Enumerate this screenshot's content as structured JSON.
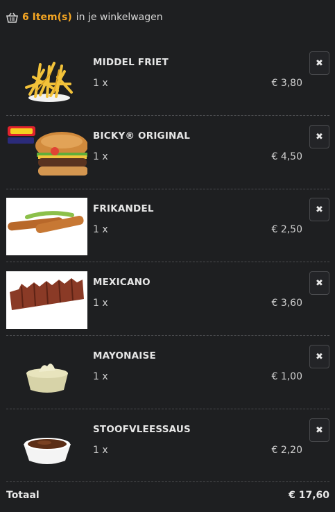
{
  "cart": {
    "count_label": "6 Item(s)",
    "suffix_label": "in je winkelwagen"
  },
  "items": [
    {
      "name": "MIDDEL FRIET",
      "qty": "1 x",
      "price": "€ 3,80",
      "remove": "✖"
    },
    {
      "name": "BICKY® ORIGINAL",
      "qty": "1 x",
      "price": "€ 4,50",
      "remove": "✖"
    },
    {
      "name": "FRIKANDEL",
      "qty": "1 x",
      "price": "€ 2,50",
      "remove": "✖"
    },
    {
      "name": "MEXICANO",
      "qty": "1 x",
      "price": "€ 3,60",
      "remove": "✖"
    },
    {
      "name": "MAYONAISE",
      "qty": "1 x",
      "price": "€ 1,00",
      "remove": "✖"
    },
    {
      "name": "STOOFVLEESSAUS",
      "qty": "1 x",
      "price": "€ 2,20",
      "remove": "✖"
    }
  ],
  "total": {
    "label": "Totaal",
    "amount": "€ 17,60"
  },
  "colors": {
    "background": "#1e1f21",
    "accent": "#f5a623"
  },
  "icons": {
    "header": "basket-icon",
    "remove": "close-icon"
  }
}
